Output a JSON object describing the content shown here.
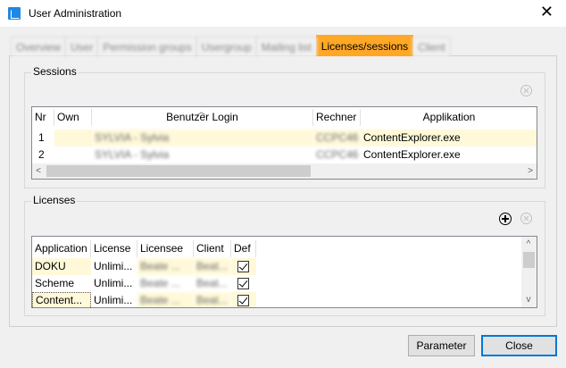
{
  "window": {
    "title": "User Administration"
  },
  "tabs": [
    {
      "label": "Overview",
      "active": false
    },
    {
      "label": "User",
      "active": false
    },
    {
      "label": "Permission groups",
      "active": false
    },
    {
      "label": "Usergroup",
      "active": false
    },
    {
      "label": "Mailing list",
      "active": false
    },
    {
      "label": "Licenses/sessions",
      "active": true
    },
    {
      "label": "Client",
      "active": false
    }
  ],
  "sessions": {
    "label": "Sessions",
    "columns": [
      "Nr",
      "Own",
      "Benutzer Login",
      "Rechner",
      "Applikation"
    ],
    "rows": [
      {
        "nr": "1",
        "own": "",
        "login": "SYLVIA - Sylvia",
        "rechner": "CCPC46",
        "app": "ContentExplorer.exe"
      },
      {
        "nr": "2",
        "own": "",
        "login": "SYLVIA - Sylvia",
        "rechner": "CCPC46",
        "app": "ContentExplorer.exe"
      }
    ],
    "scroll_left": "<",
    "scroll_right": ">"
  },
  "licenses": {
    "label": "Licenses",
    "columns": [
      "Application",
      "License",
      "Licensee",
      "Client",
      "Def"
    ],
    "rows": [
      {
        "application": "DOKU",
        "license": "Unlimi...",
        "licensee": "Beate ...",
        "client": "Beat...",
        "def": true
      },
      {
        "application": "Scheme",
        "license": "Unlimi...",
        "licensee": "Beate ...",
        "client": "Beat...",
        "def": true
      },
      {
        "application": "Content...",
        "license": "Unlimi...",
        "licensee": "Beate ...",
        "client": "Beat...",
        "def": true
      }
    ],
    "scroll_up": "^",
    "scroll_down": "v"
  },
  "buttons": {
    "parameter": "Parameter",
    "close": "Close"
  },
  "icons": {
    "close": "close-icon",
    "remove": "remove-circle-icon",
    "add": "add-circle-icon",
    "sort": "sort-asc-icon",
    "check": "checkbox-checked-icon"
  },
  "colors": {
    "active_tab": "#ffa726",
    "row_highlight": "#fff9d9",
    "default_button_border": "#0078d7"
  }
}
